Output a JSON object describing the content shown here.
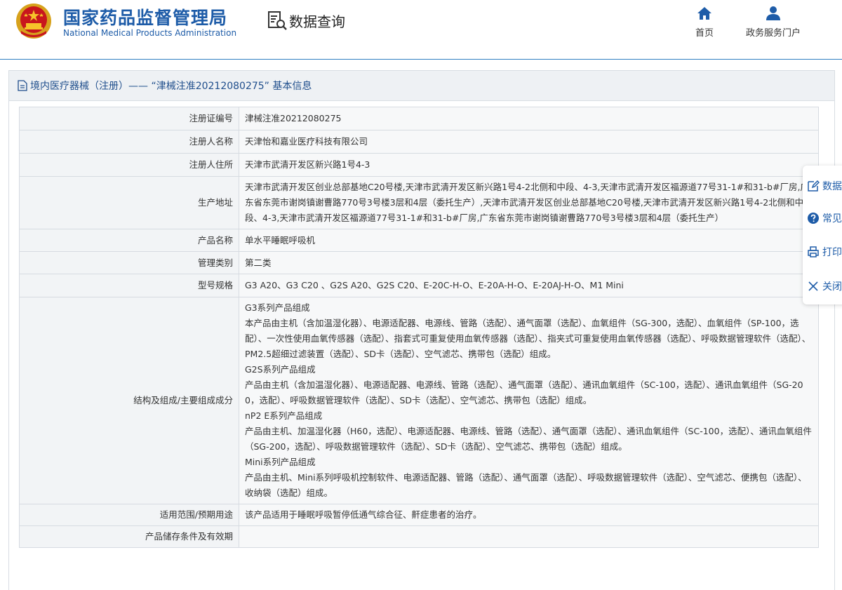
{
  "header": {
    "site_name": "国家药品监督管理局",
    "site_name_en": "National Medical Products Administration",
    "query_title": "数据查询",
    "nav": [
      {
        "label": "首页",
        "icon": "home-icon"
      },
      {
        "label": "政务服务门户",
        "icon": "user-icon"
      }
    ]
  },
  "panel": {
    "title": "境内医疗器械（注册）——  “津械注准20212080275”  基本信息"
  },
  "rows": [
    {
      "label": "注册证编号",
      "value": "津械注准20212080275"
    },
    {
      "label": "注册人名称",
      "value": "天津怡和嘉业医疗科技有限公司"
    },
    {
      "label": "注册人住所",
      "value": "天津市武清开发区新兴路1号4-3"
    },
    {
      "label": "生产地址",
      "value": "天津市武清开发区创业总部基地C20号楼,天津市武清开发区新兴路1号4-2北侧和中段、4-3,天津市武清开发区福源道77号31-1#和31-b#厂房,广东省东莞市谢岗镇谢曹路770号3号楼3层和4层（委托生产）,天津市武清开发区创业总部基地C20号楼,天津市武清开发区新兴路1号4-2北侧和中段、4-3,天津市武清开发区福源道77号31-1#和31-b#厂房,广东省东莞市谢岗镇谢曹路770号3号楼3层和4层（委托生产）"
    },
    {
      "label": "产品名称",
      "value": "单水平睡眠呼吸机"
    },
    {
      "label": "管理类别",
      "value": "第二类"
    },
    {
      "label": "型号规格",
      "value": "G3 A20、G3 C20 、G2S A20、G2S C20、E-20C-H-O、E-20A-H-O、E-20AJ-H-O、M1 Mini"
    },
    {
      "label": "结构及组成/主要组成成分",
      "value_lines": [
        "G3系列产品组成",
        "本产品由主机（含加温湿化器）、电源适配器、电源线、管路（选配）、通气面罩（选配）、血氧组件（SG-300，选配）、血氧组件（SP-100，选配）、一次性使用血氧传感器（选配）、指套式可重复使用血氧传感器（选配）、指夹式可重复使用血氧传感器（选配）、呼吸数据管理软件（选配）、PM2.5超细过滤装置（选配）、SD卡（选配）、空气滤芯、携带包（选配）组成。",
        "G2S系列产品组成",
        "产品由主机（含加温湿化器）、电源适配器、电源线、管路（选配）、通气面罩（选配）、通讯血氧组件（SC-100，选配）、通讯血氧组件（SG-200，选配）、呼吸数据管理软件（选配）、SD卡（选配）、空气滤芯、携带包（选配）组成。",
        "nP2 E系列产品组成",
        "产品由主机、加温湿化器（H60，选配）、电源适配器、电源线、管路（选配）、通气面罩（选配）、通讯血氧组件（SC-100，选配）、通讯血氧组件（SG-200，选配）、呼吸数据管理软件（选配）、SD卡（选配）、空气滤芯、携带包（选配）组成。",
        "Mini系列产品组成",
        "产品由主机、Mini系列呼吸机控制软件、电源适配器、管路（选配）、通气面罩（选配）、呼吸数据管理软件（选配）、空气滤芯、便携包（选配）、收纳袋（选配）组成。"
      ]
    },
    {
      "label": "适用范围/预期用途",
      "value": "该产品适用于睡眠呼吸暂停低通气综合征、鼾症患者的治疗。"
    },
    {
      "label": "产品储存条件及有效期",
      "value": ""
    }
  ],
  "side_toolbar": [
    {
      "label": "数据",
      "icon": "edit-icon"
    },
    {
      "label": "常见",
      "icon": "question-icon"
    },
    {
      "label": "打印",
      "icon": "printer-icon"
    },
    {
      "label": "关闭",
      "icon": "close-icon"
    }
  ],
  "colors": {
    "brand_blue": "#1e5ca8",
    "header_rule": "#2f7fc1",
    "label_bg": "#f2f4f6",
    "value_bg": "#f7f8f9",
    "panel_head_bg": "#eef1f4"
  }
}
